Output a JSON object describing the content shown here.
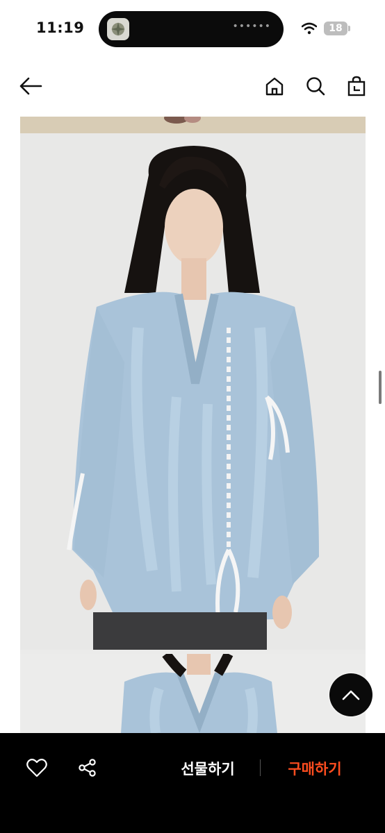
{
  "status_bar": {
    "time": "11:19",
    "battery": "18"
  },
  "header": {
    "back_icon": "arrow-left-icon",
    "home_icon": "home-icon",
    "search_icon": "search-icon",
    "cart_icon": "shopping-bag-icon"
  },
  "gallery": {
    "images": [
      "product-photo-previous",
      "product-photo-main",
      "product-photo-next"
    ]
  },
  "floating": {
    "scroll_top_icon": "chevron-up-icon"
  },
  "bottom_bar": {
    "like_icon": "heart-icon",
    "share_icon": "share-icon",
    "gift_label": "선물하기",
    "buy_label": "구매하기",
    "buy_color": "#ff4d1f"
  }
}
